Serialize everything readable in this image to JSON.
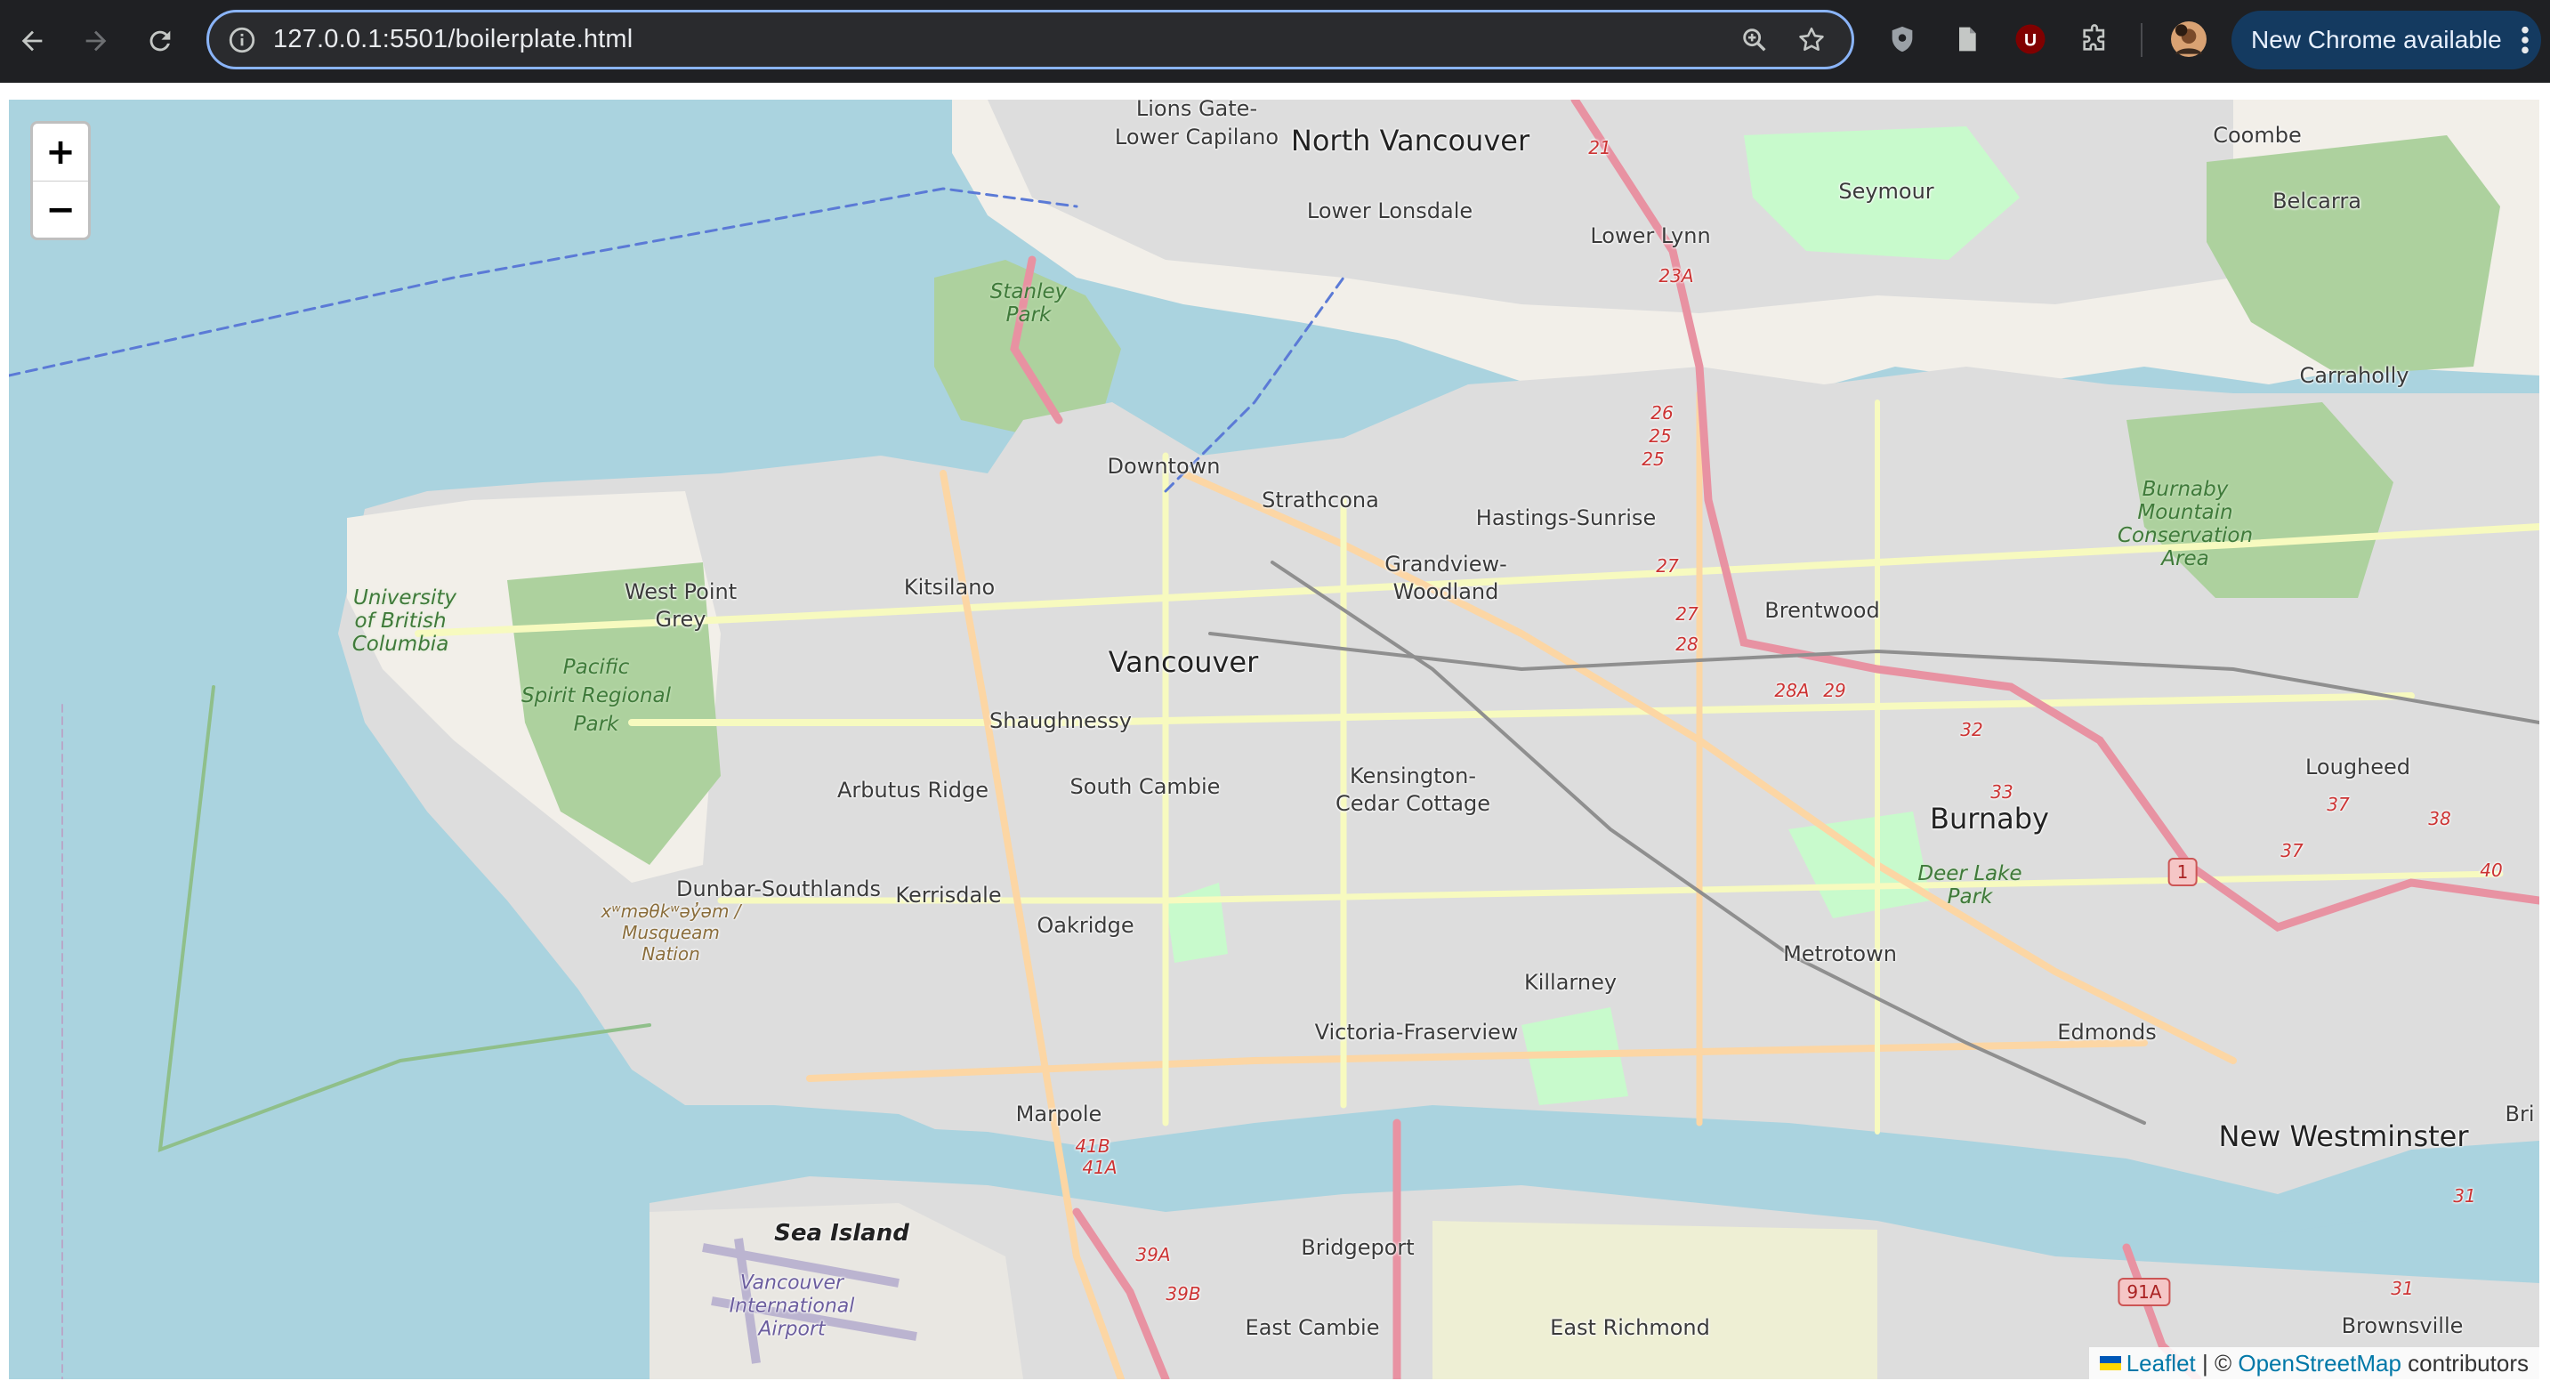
{
  "browser": {
    "url": "127.0.0.1:5501/boilerplate.html",
    "update_label": "New Chrome available",
    "accent": "#8ab4f8"
  },
  "map": {
    "zoom_in_label": "+",
    "zoom_out_label": "−",
    "attribution": {
      "leaflet": "Leaflet",
      "separator": " | © ",
      "osm": "OpenStreetMap",
      "contributors": " contributors"
    },
    "labels": {
      "vancouver": "Vancouver",
      "burnaby": "Burnaby",
      "new_westminster": "New Westminster",
      "north_vancouver": "North Vancouver",
      "lions_gate": "Lions Gate-",
      "lower_capilano": "Lower Capilano",
      "lower_lonsdale": "Lower Lonsdale",
      "lower_lynn": "Lower Lynn",
      "seymour": "Seymour",
      "coombe": "Coombe",
      "belcarra": "Belcarra",
      "carraholly": "Carraholly",
      "downtown": "Downtown",
      "strathcona": "Strathcona",
      "hastings_sunrise": "Hastings-Sunrise",
      "grandview_1": "Grandview-",
      "grandview_2": "Woodland",
      "brentwood": "Brentwood",
      "kitsilano": "Kitsilano",
      "west_point_1": "West Point",
      "west_point_2": "Grey",
      "shaughnessy": "Shaughnessy",
      "arbutus_ridge": "Arbutus Ridge",
      "south_cambie": "South Cambie",
      "kensington_1": "Kensington-",
      "kensington_2": "Cedar Cottage",
      "dunbar": "Dunbar-Southlands",
      "kerrisdale": "Kerrisdale",
      "oakridge": "Oakridge",
      "killarney": "Killarney",
      "metrotown": "Metrotown",
      "edmonds": "Edmonds",
      "victoria_fraserview": "Victoria-Fraserview",
      "marpole": "Marpole",
      "bridgeport": "Bridgeport",
      "east_cambie": "East Cambie",
      "east_richmond": "East Richmond",
      "sea_island": "Sea Island",
      "lougheed": "Lougheed",
      "brownsville": "Brownsville",
      "bri": "Bri",
      "stanley_1": "Stanley",
      "stanley_2": "Park",
      "pacific_1": "Pacific",
      "pacific_2": "Spirit Regional",
      "pacific_3": "Park",
      "ubc_1": "University",
      "ubc_2": "of British",
      "ubc_3": "Columbia",
      "burnaby_mtn_1": "Burnaby",
      "burnaby_mtn_2": "Mountain",
      "burnaby_mtn_3": "Conservation",
      "burnaby_mtn_4": "Area",
      "deer_lake_1": "Deer Lake",
      "deer_lake_2": "Park",
      "musqueam_1": "xʷməθkʷəy̓əm /",
      "musqueam_2": "Musqueam",
      "musqueam_3": "Nation",
      "yvr_1": "Vancouver",
      "yvr_2": "International",
      "yvr_3": "Airport"
    },
    "routes": [
      "21",
      "23A",
      "26",
      "25",
      "25",
      "27",
      "27",
      "28",
      "28A",
      "29",
      "32",
      "33",
      "37",
      "37",
      "38",
      "40",
      "41B",
      "41A",
      "39A",
      "39B",
      "31",
      "31"
    ],
    "shields": [
      "1",
      "91A"
    ],
    "colors": {
      "water": "#aad3df",
      "land": "#f2efe9",
      "urban": "#dddddd",
      "park": "#c8facc",
      "forest": "#add19e",
      "primary_road": "#fcd6a4",
      "secondary_road": "#f7fabf",
      "highway": "#e892a2",
      "airport": "#e9e7e2"
    }
  }
}
